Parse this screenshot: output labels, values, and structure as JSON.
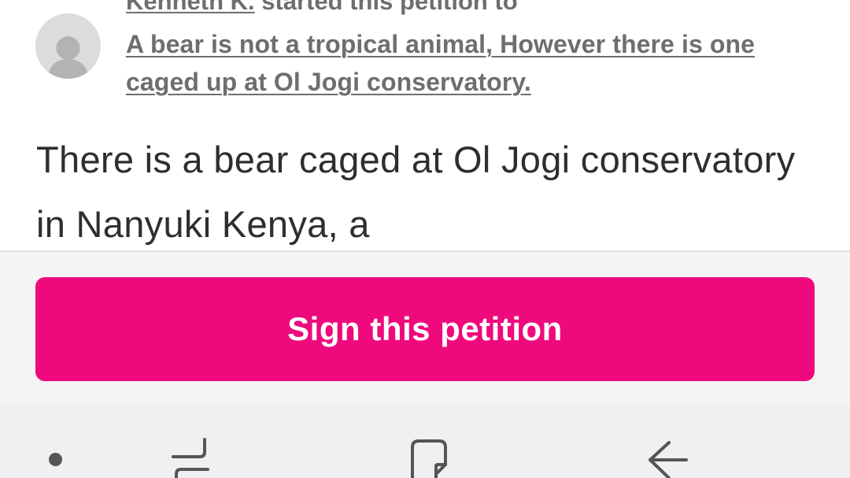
{
  "petition": {
    "author_name": "Kenneth K.",
    "started_text": " started this petition to",
    "target_title": "A bear is not a tropical animal, However there is one caged up at Ol Jogi conservatory.",
    "body_text": "There is a bear caged at Ol Jogi conservatory in Nanyuki Kenya, a"
  },
  "cta": {
    "sign_label": "Sign this petition",
    "button_color": "#ee0a7c"
  },
  "navbar": {
    "icons": [
      "dot-indicator-icon",
      "recent-apps-icon",
      "home-icon",
      "back-icon"
    ]
  }
}
